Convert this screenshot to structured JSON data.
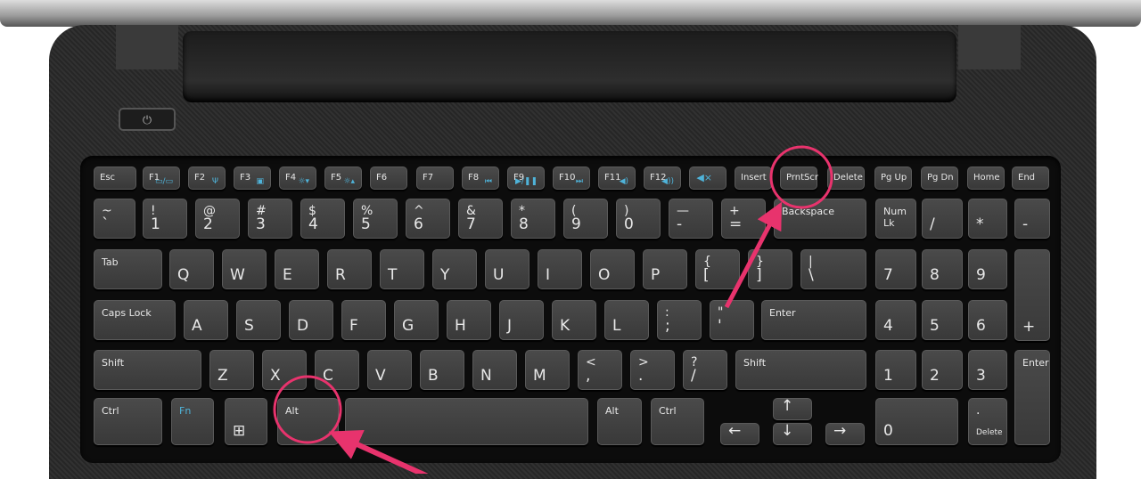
{
  "annotation_color": "#e8336d",
  "fn_color": "#4fb3d9",
  "power_icon": "power-icon",
  "keys": {
    "frow": [
      {
        "m": "Esc"
      },
      {
        "m": "F1",
        "ic": "▭/▭",
        "icon": "display-switch-icon"
      },
      {
        "m": "F2",
        "ic": "Ψ",
        "icon": "wireless-icon"
      },
      {
        "m": "F3",
        "ic": "▣",
        "icon": "battery-icon"
      },
      {
        "m": "F4",
        "ic": "☼▾",
        "icon": "brightness-down-icon"
      },
      {
        "m": "F5",
        "ic": "☼▴",
        "icon": "brightness-up-icon"
      },
      {
        "m": "F6"
      },
      {
        "m": "F7"
      },
      {
        "m": "F8",
        "ic": "⏮",
        "icon": "previous-track-icon"
      },
      {
        "m": "F9",
        "ic": "▶/❚❚",
        "icon": "play-pause-icon"
      },
      {
        "m": "F10",
        "ic": "⏭",
        "icon": "next-track-icon"
      },
      {
        "m": "F11",
        "ic": "◀)",
        "icon": "volume-down-icon"
      },
      {
        "m": "F12",
        "ic": "◀))",
        "icon": "volume-up-icon"
      },
      {
        "m": "",
        "ic": "◀×",
        "icon": "mute-icon"
      },
      {
        "m": "Insert"
      },
      {
        "m": "PrntScr"
      },
      {
        "m": "Delete"
      },
      {
        "m": "Pg Up"
      },
      {
        "m": "Pg Dn"
      },
      {
        "m": "Home"
      },
      {
        "m": "End"
      }
    ],
    "row1": [
      {
        "s": "~",
        "m": "`"
      },
      {
        "s": "!",
        "m": "1"
      },
      {
        "s": "@",
        "m": "2"
      },
      {
        "s": "#",
        "m": "3"
      },
      {
        "s": "$",
        "m": "4"
      },
      {
        "s": "%",
        "m": "5"
      },
      {
        "s": "^",
        "m": "6"
      },
      {
        "s": "&",
        "m": "7"
      },
      {
        "s": "*",
        "m": "8"
      },
      {
        "s": "(",
        "m": "9"
      },
      {
        "s": ")",
        "m": "0"
      },
      {
        "s": "—",
        "m": "-"
      },
      {
        "s": "+",
        "m": "="
      },
      {
        "m": "Backspace",
        "mod": 1
      },
      {
        "m": "Num Lk",
        "mod": 1
      },
      {
        "m": "/"
      },
      {
        "m": "*"
      },
      {
        "m": "-"
      }
    ],
    "row2": [
      {
        "m": "Tab",
        "mod": 1
      },
      {
        "m": "Q"
      },
      {
        "m": "W"
      },
      {
        "m": "E"
      },
      {
        "m": "R"
      },
      {
        "m": "T"
      },
      {
        "m": "Y"
      },
      {
        "m": "U"
      },
      {
        "m": "I"
      },
      {
        "m": "O"
      },
      {
        "m": "P"
      },
      {
        "s": "{",
        "m": "["
      },
      {
        "s": "}",
        "m": "]"
      },
      {
        "s": "|",
        "m": "\\"
      },
      {
        "m": "7"
      },
      {
        "m": "8"
      },
      {
        "m": "9"
      },
      {
        "m": "+"
      }
    ],
    "row3": [
      {
        "m": "Caps Lock",
        "mod": 1
      },
      {
        "m": "A"
      },
      {
        "m": "S"
      },
      {
        "m": "D"
      },
      {
        "m": "F"
      },
      {
        "m": "G"
      },
      {
        "m": "H"
      },
      {
        "m": "J"
      },
      {
        "m": "K"
      },
      {
        "m": "L"
      },
      {
        "s": ":",
        "m": ";"
      },
      {
        "s": "\"",
        "m": "'"
      },
      {
        "m": "Enter",
        "mod": 1
      },
      {
        "m": "4"
      },
      {
        "m": "5"
      },
      {
        "m": "6"
      }
    ],
    "row4": [
      {
        "m": "Shift",
        "mod": 1
      },
      {
        "m": "Z"
      },
      {
        "m": "X"
      },
      {
        "m": "C"
      },
      {
        "m": "V"
      },
      {
        "m": "B"
      },
      {
        "m": "N"
      },
      {
        "m": "M"
      },
      {
        "s": "<",
        "m": ","
      },
      {
        "s": ">",
        "m": "."
      },
      {
        "s": "?",
        "m": "/"
      },
      {
        "m": "Shift",
        "mod": 1
      },
      {
        "m": "1"
      },
      {
        "m": "2"
      },
      {
        "m": "3"
      },
      {
        "m": "Enter",
        "mod": 1
      }
    ],
    "row5": [
      {
        "m": "Ctrl",
        "mod": 1
      },
      {
        "m": "Fn",
        "mod": 1,
        "blue": 1
      },
      {
        "m": "⊞",
        "icon": "windows-icon"
      },
      {
        "m": "Alt",
        "mod": 1
      },
      {
        "m": ""
      },
      {
        "m": "Alt",
        "mod": 1
      },
      {
        "m": "Ctrl",
        "mod": 1
      },
      {
        "m": "↑"
      },
      {
        "m": "←"
      },
      {
        "m": "↓"
      },
      {
        "m": "→"
      },
      {
        "m": "0"
      },
      {
        "s": ".",
        "m": "Delete",
        "mod2": 1
      }
    ]
  }
}
